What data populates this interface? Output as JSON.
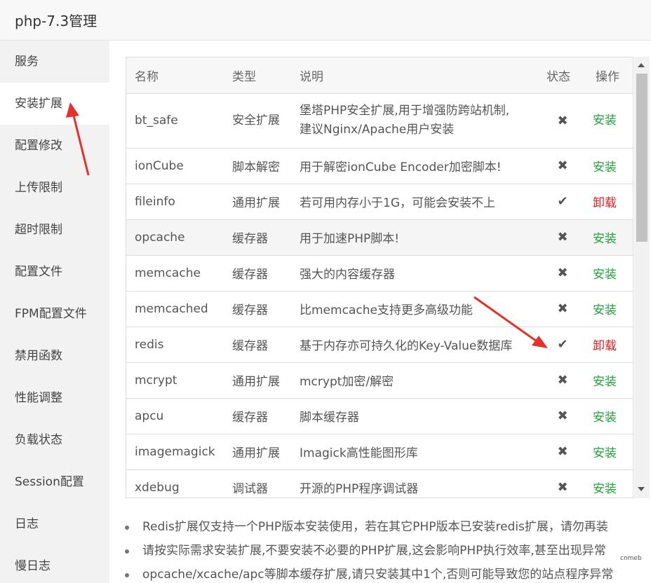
{
  "window": {
    "title": "php-7.3管理"
  },
  "sidebar": {
    "items": [
      {
        "label": "服务"
      },
      {
        "label": "安装扩展"
      },
      {
        "label": "配置修改"
      },
      {
        "label": "上传限制"
      },
      {
        "label": "超时限制"
      },
      {
        "label": "配置文件"
      },
      {
        "label": "FPM配置文件"
      },
      {
        "label": "禁用函数"
      },
      {
        "label": "性能调整"
      },
      {
        "label": "负载状态"
      },
      {
        "label": "Session配置"
      },
      {
        "label": "日志"
      },
      {
        "label": "慢日志"
      }
    ],
    "active_index": 1
  },
  "table": {
    "headers": {
      "name": "名称",
      "type": "类型",
      "desc": "说明",
      "status": "状态",
      "op": "操作"
    },
    "rows": [
      {
        "name": "bt_safe",
        "type": "安全扩展",
        "desc_line1": "堡塔PHP安全扩展,用于增强防跨站机制,",
        "desc_line2": "建议Nginx/Apache用户安装",
        "status": "✖",
        "op": "安装"
      },
      {
        "name": "ionCube",
        "type": "脚本解密",
        "desc": "用于解密ionCube Encoder加密脚本!",
        "status": "✖",
        "op": "安装"
      },
      {
        "name": "fileinfo",
        "type": "通用扩展",
        "desc": "若可用内存小于1G，可能会安装不上",
        "status": "✔",
        "op": "卸载"
      },
      {
        "name": "opcache",
        "type": "缓存器",
        "desc": "用于加速PHP脚本!",
        "status": "✖",
        "op": "安装"
      },
      {
        "name": "memcache",
        "type": "缓存器",
        "desc": "强大的内容缓存器",
        "status": "✖",
        "op": "安装"
      },
      {
        "name": "memcached",
        "type": "缓存器",
        "desc": "比memcache支持更多高级功能",
        "status": "✖",
        "op": "安装"
      },
      {
        "name": "redis",
        "type": "缓存器",
        "desc": "基于内存亦可持久化的Key-Value数据库",
        "status": "✔",
        "op": "卸载"
      },
      {
        "name": "mcrypt",
        "type": "通用扩展",
        "desc": "mcrypt加密/解密",
        "status": "✖",
        "op": "安装"
      },
      {
        "name": "apcu",
        "type": "缓存器",
        "desc": "脚本缓存器",
        "status": "✖",
        "op": "安装"
      },
      {
        "name": "imagemagick",
        "type": "通用扩展",
        "desc": "Imagick高性能图形库",
        "status": "✖",
        "op": "安装"
      },
      {
        "name": "xdebug",
        "type": "调试器",
        "desc": "开源的PHP程序调试器",
        "status": "✖",
        "op": "安装"
      }
    ]
  },
  "notes": [
    "Redis扩展仅支持一个PHP版本安装使用，若在其它PHP版本已安装redis扩展，请勿再装",
    "请按实际需求安装扩展,不要安装不必要的PHP扩展,这会影响PHP执行效率,甚至出现异常",
    "opcache/xcache/apc等脚本缓存扩展,请只安装其中1个,否则可能导致您的站点程序异常"
  ],
  "watermark": "cnmeb",
  "colors": {
    "install": "#20a53a",
    "uninstall": "#e02020",
    "annotation_arrow": "#e8302a"
  },
  "icons": {
    "installed": "check-icon",
    "not_installed": "cross-icon"
  }
}
